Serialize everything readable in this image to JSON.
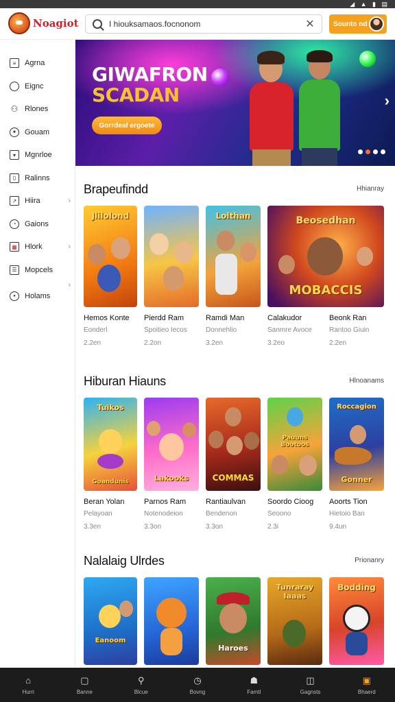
{
  "header": {
    "logo_text": "Noagiot",
    "search_value": "I hiouksamaos.focnonom",
    "user_button_label": "Sounto nd"
  },
  "sidebar": {
    "items": [
      {
        "label": "Agrna",
        "icon": "grid-icon",
        "chevron": false
      },
      {
        "label": "Eignc",
        "icon": "clock-icon",
        "chevron": false
      },
      {
        "label": "Rlones",
        "icon": "users-icon",
        "chevron": false
      },
      {
        "label": "Gouam",
        "icon": "compass-icon",
        "chevron": false
      },
      {
        "label": "Mgnrloe",
        "icon": "bookmark-icon",
        "chevron": false
      },
      {
        "label": "Ralinns",
        "icon": "book-icon",
        "chevron": false
      },
      {
        "label": "Hiira",
        "icon": "page-icon",
        "chevron": true
      },
      {
        "label": "Gaions",
        "icon": "gauge-icon",
        "chevron": false
      },
      {
        "label": "Hlork",
        "icon": "calendar-icon",
        "chevron": true
      },
      {
        "label": "Mopcels",
        "icon": "list-icon",
        "chevron": false
      },
      {
        "label": "Holams",
        "icon": "target-icon",
        "chevron": true
      }
    ]
  },
  "banner": {
    "title_line1": "GIWAFRON",
    "title_line2": "SCADAN",
    "button_label": "Gorrdeaf ergoete",
    "slide_count": 4,
    "active_slide": 2
  },
  "sections": [
    {
      "title": "Brapeufindd",
      "link": "Hhianray",
      "cards": [
        {
          "name": "Hemos Konte",
          "sub": "Eonderl",
          "size": "2.2en",
          "art": "Jlilolond",
          "bottom": ""
        },
        {
          "name": "Pierdd Ram",
          "sub": "Spoitieo Iecos",
          "size": "2.2on",
          "art": "Lolthan",
          "bottom": ""
        },
        {
          "name": "Ramdi Man",
          "sub": "Donnehlio",
          "size": "3.2en",
          "art": "",
          "bottom": ""
        },
        {
          "name": "Calakudor",
          "sub": "Sanmre Avoce",
          "size": "3.2eo",
          "art": "Beosedhan",
          "bottom": "MOBACCIS"
        },
        {
          "name": "Beonk Ran",
          "sub": "Rantoo Giuin",
          "size": "2.2en",
          "art": "",
          "bottom": ""
        }
      ]
    },
    {
      "title": "Hiburan Hiauns",
      "link": "Hlnoanams",
      "cards": [
        {
          "name": "Beran Yolan",
          "sub": "Pelayoan",
          "size": "3.3en",
          "art": "Tuikos",
          "bottom": "Goandunis"
        },
        {
          "name": "Parnos Ram",
          "sub": "Notenodeion",
          "size": "3.3on",
          "art": "",
          "bottom": "Lakooks"
        },
        {
          "name": "Rantiaulvan",
          "sub": "Bendenon",
          "size": "3.3on",
          "art": "",
          "bottom": "COMMAS"
        },
        {
          "name": "Soordo Cioog",
          "sub": "Seoono",
          "size": "2.3i",
          "art": "",
          "bottom": "Pauuns Bootoos"
        },
        {
          "name": "Aoorts Tion",
          "sub": "Hietoio Ban",
          "size": "9.4un",
          "art": "Roccagion",
          "bottom": "Gonner"
        }
      ]
    },
    {
      "title": "Nalalaig Ulrdes",
      "link": "Prionanry",
      "cards": [
        {
          "name": "",
          "sub": "",
          "size": "",
          "art": "",
          "bottom": "Eanoom"
        },
        {
          "name": "",
          "sub": "",
          "size": "",
          "art": "",
          "bottom": ""
        },
        {
          "name": "",
          "sub": "",
          "size": "",
          "art": "",
          "bottom": "Haroes"
        },
        {
          "name": "",
          "sub": "",
          "size": "",
          "art": "Tunraray Iaaas",
          "bottom": ""
        },
        {
          "name": "",
          "sub": "",
          "size": "",
          "art": "Bodding",
          "bottom": ""
        }
      ]
    }
  ],
  "bottom_nav": [
    {
      "label": "Hurri",
      "icon": "home-icon"
    },
    {
      "label": "Banne",
      "icon": "square-icon"
    },
    {
      "label": "Blcue",
      "icon": "search-icon"
    },
    {
      "label": "Bovng",
      "icon": "compass-icon"
    },
    {
      "label": "Famtl",
      "icon": "bell-icon"
    },
    {
      "label": "Gagnsts",
      "icon": "library-icon"
    },
    {
      "label": "Bhaerd",
      "icon": "profile-icon"
    }
  ],
  "colors": {
    "accent": "#f4a11f",
    "brand": "#d0222a",
    "active_dot": "#ff6a2a"
  }
}
